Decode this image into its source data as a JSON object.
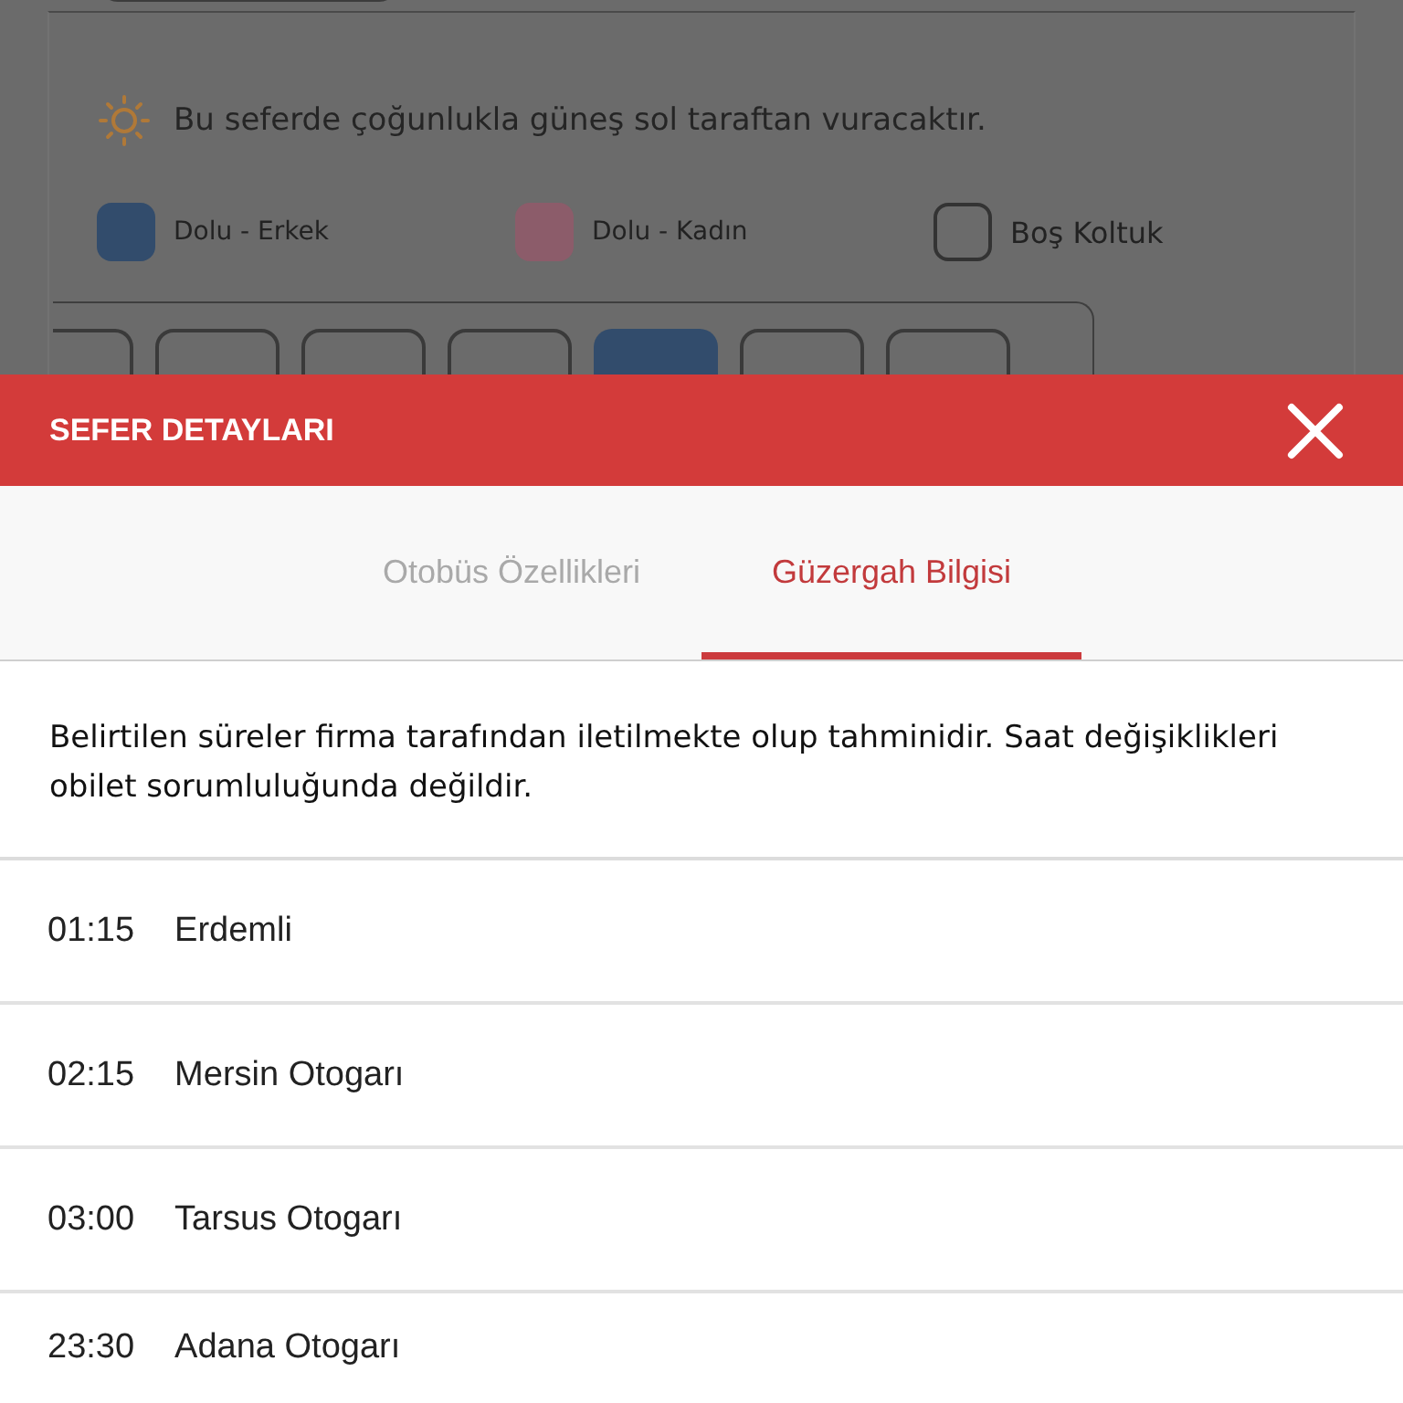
{
  "background": {
    "sun_note": "Bu seferde çoğunlukla güneş sol taraftan vuracaktır.",
    "legend": [
      {
        "kind": "male",
        "label": "Dolu - Erkek"
      },
      {
        "kind": "female",
        "label": "Dolu - Kadın"
      },
      {
        "kind": "empty",
        "label": "Boş Koltuk"
      }
    ],
    "seats": [
      {
        "kind": "empty"
      },
      {
        "kind": "empty"
      },
      {
        "kind": "empty"
      },
      {
        "kind": "empty"
      },
      {
        "kind": "male"
      },
      {
        "kind": "empty"
      },
      {
        "kind": "empty"
      }
    ]
  },
  "sheet": {
    "title": "SEFER DETAYLARI",
    "tabs": [
      {
        "label": "Otobüs Özellikleri",
        "selected": false
      },
      {
        "label": "Güzergah Bilgisi",
        "selected": true
      }
    ],
    "notice": "Belirtilen süreler firma tarafından iletilmekte olup tahminidir. Saat değişiklikleri obilet sorumluluğunda değildir.",
    "stops": [
      {
        "time": "01:15",
        "place": "Erdemli"
      },
      {
        "time": "02:15",
        "place": "Mersin Otogarı"
      },
      {
        "time": "03:00",
        "place": "Tarsus Otogarı"
      },
      {
        "time": "23:30",
        "place": "Adana Otogarı"
      }
    ]
  }
}
